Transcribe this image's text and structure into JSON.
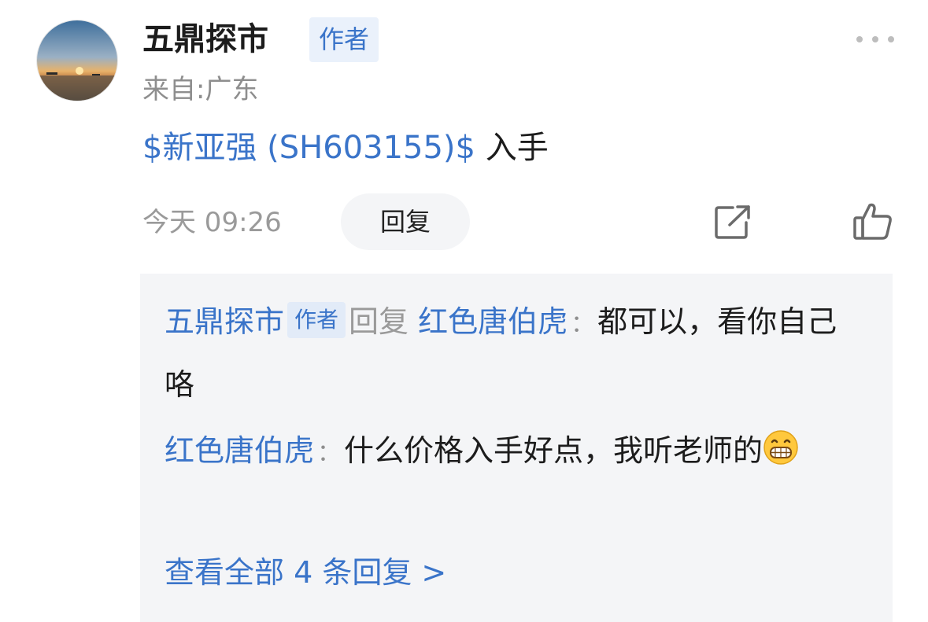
{
  "post": {
    "username": "五鼎探市",
    "author_badge": "作者",
    "location": "来自:广东",
    "stock_link": "$新亚强 (SH603155)$",
    "content_text": " 入手",
    "timestamp": "今天 09:26",
    "reply_label": "回复"
  },
  "icons": {
    "more": "more-icon",
    "share": "share-icon",
    "like": "thumbs-up-icon",
    "emoji": "grin-emoji"
  },
  "replies": [
    {
      "author": "五鼎探市",
      "author_badge": "作者",
      "reply_word": "回复",
      "target": "红色唐伯虎",
      "colon": "：",
      "text": "都可以，看你自己咯"
    },
    {
      "author": "红色唐伯虎",
      "colon": "：",
      "text": "什么价格入手好点，我听老师的"
    }
  ],
  "view_all": "查看全部 4 条回复 >",
  "colors": {
    "link_blue": "#3a74c9",
    "reply_bg": "#f4f5f7",
    "badge_bg": "#eaf1fb",
    "muted": "#9a9a9a"
  }
}
